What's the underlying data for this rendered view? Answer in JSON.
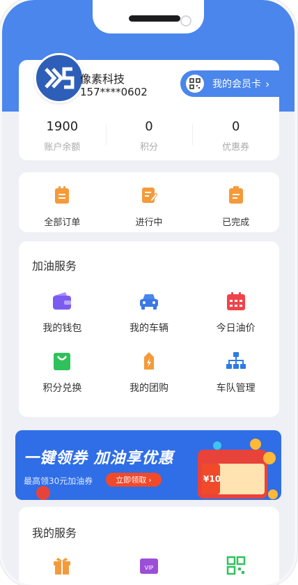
{
  "profile": {
    "name": "像素科技",
    "phone": "157****0602",
    "member_label": "我的会员卡"
  },
  "stats": [
    {
      "value": "1900",
      "label": "账户余额"
    },
    {
      "value": "0",
      "label": "积分"
    },
    {
      "value": "0",
      "label": "优惠券"
    }
  ],
  "orders": [
    "全部订单",
    "进行中",
    "已完成"
  ],
  "service": {
    "title": "加油服务",
    "items": [
      "我的钱包",
      "我的车辆",
      "今日油价",
      "积分兑换",
      "我的团购",
      "车队管理"
    ]
  },
  "banner": {
    "title": "一键领券  加油享优惠",
    "subtitle": "最高领30元加油券",
    "button": "立即领取",
    "coupon_value": "¥10"
  },
  "my_service": {
    "title": "我的服务"
  },
  "colors": {
    "primary": "#4a86ec",
    "orange": "#f59a3a",
    "red": "#f04a2b"
  }
}
